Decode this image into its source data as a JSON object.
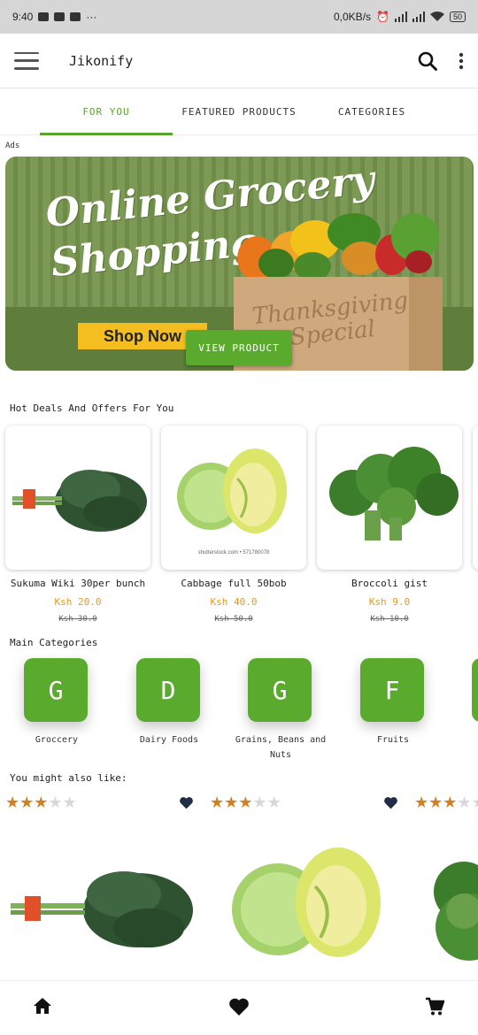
{
  "status_bar": {
    "time": "9:40",
    "more": "···",
    "network_speed": "0,0KB/s",
    "battery": "50"
  },
  "app_bar": {
    "title": "Jikonify"
  },
  "tabs": [
    {
      "label": "FOR YOU",
      "active": true
    },
    {
      "label": "FEATURED PRODUCTS",
      "active": false
    },
    {
      "label": "CATEGORIES",
      "active": false
    }
  ],
  "ads": {
    "label": "Ads",
    "banner_line1": "Online Grocery",
    "banner_line2": "Shopping",
    "shop_now": "Shop Now",
    "bag_text_line1": "Thanksgiving",
    "bag_text_line2": "Special",
    "view_product": "VIEW PRODUCT"
  },
  "hot_deals": {
    "title": "Hot Deals And Offers For You",
    "items": [
      {
        "name": "Sukuma Wiki 30per bunch",
        "price": "Ksh 20.0",
        "old_price": "Ksh 30.0",
        "image": "sukuma-wiki-image",
        "caption": ""
      },
      {
        "name": "Cabbage full 50bob",
        "price": "Ksh 40.0",
        "old_price": "Ksh 50.0",
        "image": "cabbage-image",
        "caption": "shutterstock.com • 571780078"
      },
      {
        "name": "Broccoli gist",
        "price": "Ksh 9.0",
        "old_price": "Ksh 10.0",
        "image": "broccoli-image",
        "caption": ""
      }
    ]
  },
  "main_categories": {
    "title": "Main Categories",
    "items": [
      {
        "letter": "G",
        "label": "Groccery"
      },
      {
        "letter": "D",
        "label": "Dairy Foods"
      },
      {
        "letter": "G",
        "label": "Grains, Beans and Nuts"
      },
      {
        "letter": "F",
        "label": "Fruits"
      }
    ]
  },
  "suggestions": {
    "title": "You might also like:",
    "items": [
      {
        "rating": 3,
        "max_rating": 5,
        "image": "sukuma-wiki-image"
      },
      {
        "rating": 3,
        "max_rating": 5,
        "image": "cabbage-image"
      },
      {
        "rating": 3,
        "max_rating": 5,
        "image": "greens-image"
      }
    ]
  },
  "colors": {
    "accent": "#5aab2d",
    "price": "#e19a2e",
    "star": "#d5801f",
    "heart": "#1f2d46"
  },
  "bottom_nav": {
    "icons": [
      "home-icon",
      "heart-icon",
      "cart-icon"
    ]
  }
}
